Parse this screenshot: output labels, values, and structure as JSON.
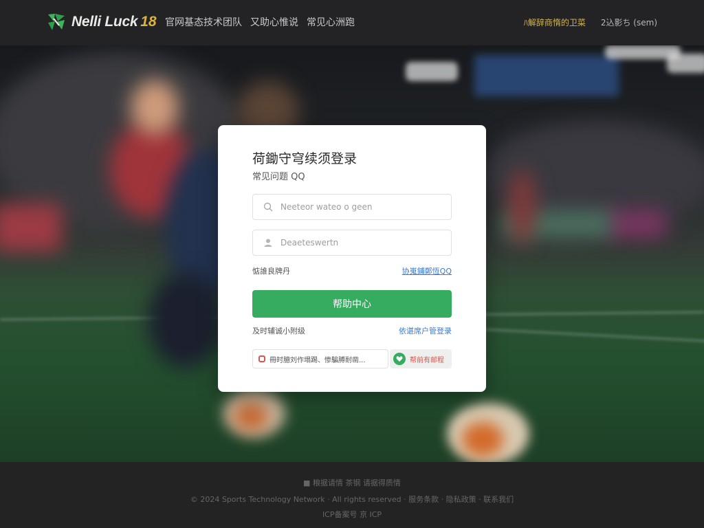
{
  "header": {
    "logo_text": "Nelli Luck",
    "logo_number": "18",
    "nav": [
      "官网基态技术团队",
      "又助心惟说",
      "常见心洲跑"
    ],
    "right_links": [
      "ﾊ解辞商惰的卫菜",
      "2込影ち (sem)"
    ]
  },
  "card": {
    "title": "荷鋤守穹续须登录",
    "subtitle": "常见问题 QQ",
    "username_placeholder": "Neeteor wateo o geen",
    "password_placeholder": "Deaeteswertn",
    "remember_label": "惦誰良牌丹",
    "forgot_link": "协嵬鋪鄭恆QQ",
    "submit_label": "帮助中心",
    "footer_left": "及时辅诚小附级",
    "footer_right": "依谌席户管登录",
    "notice_text": "冊时臆刘作塌踢、惨騙膊耐凿...",
    "badge_text": "帮前有邮程"
  },
  "footer": {
    "line1": "■ 粮据请情 茶钢 请据得质情",
    "line2": "© 2024 Sports Technology Network · All rights reserved · 服务条款 · 隐私政策 · 联系我们",
    "line3": "ICP备案号 京 ICP"
  },
  "colors": {
    "accent_green": "#35ac5f",
    "link_blue": "#3a7bd5",
    "header_bg": "#232325",
    "gold": "#d4b64e"
  },
  "icons": {
    "username_field": "search-icon",
    "password_field": "user-icon",
    "notice": "alert-icon",
    "badge": "heart-icon"
  }
}
